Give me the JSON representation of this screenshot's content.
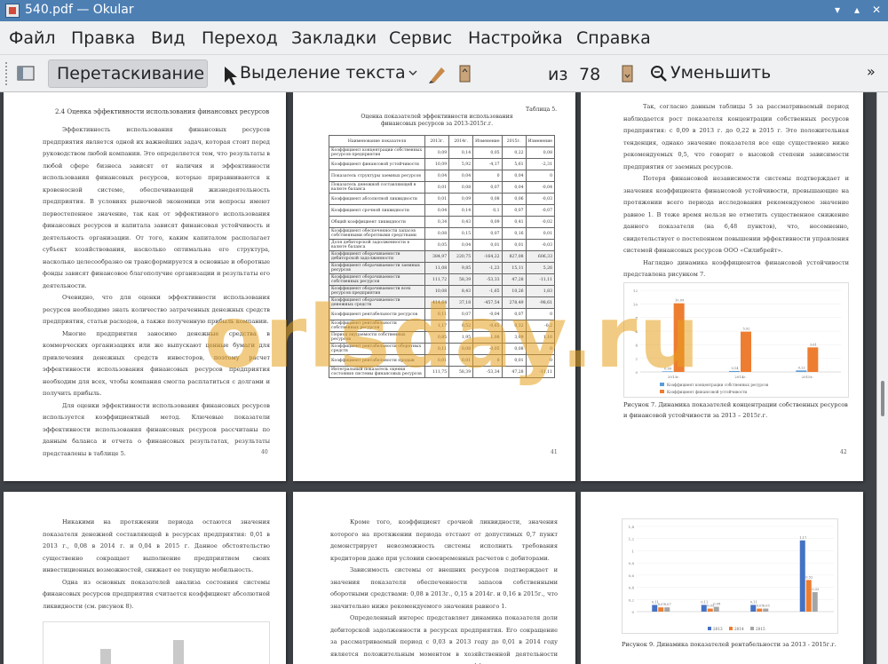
{
  "window": {
    "title": "540.pdf — Okular"
  },
  "menu": [
    "Файл",
    "Правка",
    "Вид",
    "Переход",
    "Закладки",
    "Сервис",
    "Настройка",
    "Справка"
  ],
  "toolbar": {
    "drag": "Перетаскивание",
    "select": "Выделение текста",
    "page": "41",
    "of": "из",
    "total": "78",
    "zoom": "Уменьшить"
  },
  "watermark": "orlsday.ru",
  "p40": {
    "heading": "2.4 Оценка эффективности использования финансовых ресурсов",
    "paras": [
      "Эффективность использования финансовых ресурсов предприятия является одной их важнейших задач, которая стоит перед руководством любой компании. Это определяется тем, что результаты в любой сфере бизнеса зависят от наличия и эффективности использования финансовых ресурсов, которые приравниваются к кровеносной системе, обеспечивающей жизнедеятельность предприятия. В условиях рыночной экономики эти вопросы имеют первостепенное значение, так как от эффективного использования финансовых ресурсов и капитала зависят финансовая устойчивость и деятельность организации. От того, каким капиталом располагает субъект хозяйствования, насколько оптимальна его структура, насколько целесообразно он трансформируется в основные и оборотные фонды зависят финансовое благополучие организации и результаты его деятельности.",
      "Очевидно, что для оценки эффективности использования ресурсов необходимо знать количество затраченных денежных средств предприятия, статьи расходов, а также полученную прибыль компании.",
      "Многие предприятия заносимо денежные средства в коммерческих организациях или же выпускают ценные бумаги для привлечения денежных средств инвесторов, поэтому расчет эффективности использования финансовых ресурсов предприятия необходим для всех, чтобы компания смогла расплатиться с долгами и получить прибыль.",
      "Для оценки эффективности использования финансовых ресурсов используется коэффициентный метод. Ключевые показатели эффективности использования финансовых ресурсов рассчитаны по данным баланса и отчета о финансовых результатах, результаты представлены в таблице 5."
    ],
    "num": "40"
  },
  "p41": {
    "tablelabel": "Таблица 5.",
    "caption": "Оценка показателей эффективности использования финансовых ресурсов за 2013-2015г.г.",
    "head": [
      "Наименование показателя",
      "2013г.",
      "2014г.",
      "Изменение",
      "2015г.",
      "Изменение"
    ],
    "rows": [
      [
        "Коэффициент концентрации собственных ресурсов предприятия",
        "0,09",
        "0,14",
        "0,05",
        "0,22",
        "0,08"
      ],
      [
        "Коэффициент финансовой устойчивости",
        "10,09",
        "5,92",
        "-4,17",
        "5,61",
        "-2,31"
      ],
      [
        "Показатель структуры заемных ресурсов",
        "0,04",
        "0,04",
        "0",
        "0,04",
        "0"
      ],
      [
        "Показатель денежной составляющей в валюте баланса",
        "0,01",
        "0,08",
        "0,07",
        "0,04",
        "-0,04"
      ],
      [
        "Коэффициент абсолютной ликвидности",
        "0,01",
        "0,09",
        "0,08",
        "0,06",
        "-0,03"
      ],
      [
        "Коэффициент срочной ликвидности",
        "0,04",
        "0,14",
        "0,1",
        "0,07",
        "-0,07"
      ],
      [
        "Общий коэффициент ликвидности",
        "0,34",
        "0,43",
        "0,09",
        "0,41",
        "-0,02"
      ],
      [
        "Коэффициент обеспеченности запасов собственными оборотными средствами",
        "0,08",
        "0,15",
        "0,07",
        "0,16",
        "0,01"
      ],
      [
        "Доля дебиторской задолженности в валюте баланса",
        "0,05",
        "0,04",
        "0,01",
        "0,01",
        "-0,03"
      ],
      [
        "Коэффициент оборачиваемости дебиторской задолженности",
        "384,97",
        "220,75",
        "-164,22",
        "827,08",
        "606,33"
      ],
      [
        "Коэффициент оборачиваемости заемных ресурсов",
        "11,08",
        "9,85",
        "-1,23",
        "15,11",
        "5,26"
      ],
      [
        "Коэффициент оборачиваемости собственных ресурсов",
        "111,72",
        "58,39",
        "-53,33",
        "47,28",
        "-11,11"
      ],
      [
        "Коэффициент оборачиваемости всех ресурсов предприятия",
        "10,08",
        "8,43",
        "-1,65",
        "10,26",
        "1,83"
      ],
      [
        "Коэффициент оборачиваемости денежных средств",
        "414,64",
        "37,18",
        "-457,54",
        "278,49",
        "-98,61"
      ],
      [
        "Коэффициент рентабельности ресурсов",
        "0,11",
        "0,07",
        "-0,04",
        "0,07",
        "0"
      ],
      [
        "Коэффициент рентабельности собственных ресурсов",
        "1,17",
        "0,52",
        "-0,65",
        "0,32",
        "-0,2"
      ],
      [
        "Период окупаемости собственных ресурсов",
        "0,85",
        "1,95",
        "1,08",
        "3,09",
        "1,16"
      ],
      [
        "Коэффициент рентабельности оборотных средств",
        "0,11",
        "0,08",
        "-0,05",
        "0,08",
        "0"
      ],
      [
        "Коэффициент рентабельности продаж",
        "0,01",
        "0,01",
        "0",
        "0,01",
        "0"
      ],
      [
        "Интегральный показатель оценки состояния системы финансовых ресурсов",
        "111,75",
        "58,39",
        "-53,34",
        "47,28",
        "-11,11"
      ]
    ],
    "num": "41"
  },
  "p42": {
    "paras": [
      "Так, согласно данным таблицы 5 за рассматриваемый период наблюдается рост показателя концентрации собственных ресурсов предприятия: с 0,09 в 2013 г. до 0,22 в 2015 г. Это положительная тенденция, однако значение показателя все еще существенно ниже рекомендуемых 0,5, что говорит о высокой степени зависимости предприятия от заемных ресурсов.",
      "Потеря финансовой независимости системы подтверждает и значения коэффициента финансовой устойчивости, превышающие на протяжении всего периода исследования рекомендуемое значение равное 1. В тоже время нельзя не отметить существенное снижение данного показателя (на 6,48 пунктов), что, несомненно, свидетельствует о постепенном повышении эффективности управления системой финансовых ресурсов ООО «Силибрейт».",
      "Наглядно динамика коэффициентов финансовой устойчивости представлена рисунком 7."
    ],
    "figcap": "Рисунок 7. Динамика показателей концентрации собственных ресурсов и финансовой устойчивости за 2013 – 2015г.г.",
    "legend": [
      "Коэффициент концентрации собственных ресурсов",
      "Коэффициент финансовой устойчивости"
    ],
    "num": "42"
  },
  "p43": {
    "paras": [
      "Никакими на протяжении периода остаются значения показателя денежной составляющей в ресурсах предприятия: 0,01 в 2013 г., 0,08 в 2014 г. и 0,04 в 2015 г. Данное обстоятельство существенно сокращает выполнение предприятием своих инвестиционных возможностей, снижает ее текущую мобильность.",
      "Одна из основных показателей анализа состояния системы финансовых ресурсов предприятия считается коэффициент абсолютной ликвидности (см. рисунок 8)."
    ]
  },
  "p44": {
    "paras": [
      "Кроме того, коэффициент срочной ликвидности, значения которого на протяжении периода отстают от допустимых 0,7 пункт демонстрирует невозможность системы исполнить требования кредиторов даже при условии своевременных расчетов с дебиторами.",
      "Зависимость системы от внешних ресурсов подтверждает и значения показателя обеспеченности запасов собственными оборотными средствами: 0,08 в 2013г., 0,15 в 2014г. и 0,16 в 2015г., что значительно ниже рекомендуемого значения равного 1.",
      "Определенный интерес представляет динамика показателя доли дебиторской задолженности в ресурсах предприятия. Его сокращение за рассматриваемый период с 0,03 в 2013 году до 0,01 в 2014 году является положительным моментом в хозяйственной деятельности предприятия, и говорит снижении неэффективного отвлечения ресурсов предприятия."
    ]
  },
  "p45": {
    "figcap": "Рисунок 9. Динамика показателей рентабельности за 2013 - 2015г.г.",
    "legend": [
      "2013",
      "2014",
      "2015"
    ]
  },
  "chart_data": [
    {
      "type": "bar",
      "categories": [
        "2013г.",
        "2014г.",
        "2015г."
      ],
      "series": [
        {
          "name": "Коэффициент концентрации собственных ресурсов",
          "values": [
            0.09,
            0.14,
            0.22
          ]
        },
        {
          "name": "Коэффициент финансовой устойчивости",
          "values": [
            10.09,
            5.92,
            3.61
          ]
        }
      ],
      "ylim": [
        0,
        12
      ],
      "colors": [
        "#5b9bd5",
        "#ed7d31"
      ]
    },
    {
      "type": "bar",
      "categories": [
        "",
        "",
        "",
        ""
      ],
      "series": [
        {
          "name": "2013",
          "values": [
            0.11,
            0.11,
            0.11,
            1.17
          ]
        },
        {
          "name": "2014",
          "values": [
            0.07,
            0.05,
            0.05,
            0.52
          ]
        },
        {
          "name": "2015",
          "values": [
            0.07,
            0.08,
            0.05,
            0.32
          ]
        }
      ],
      "ylim": [
        0,
        1.4
      ],
      "colors": [
        "#4472c4",
        "#ed7d31",
        "#a5a5a5"
      ]
    }
  ]
}
